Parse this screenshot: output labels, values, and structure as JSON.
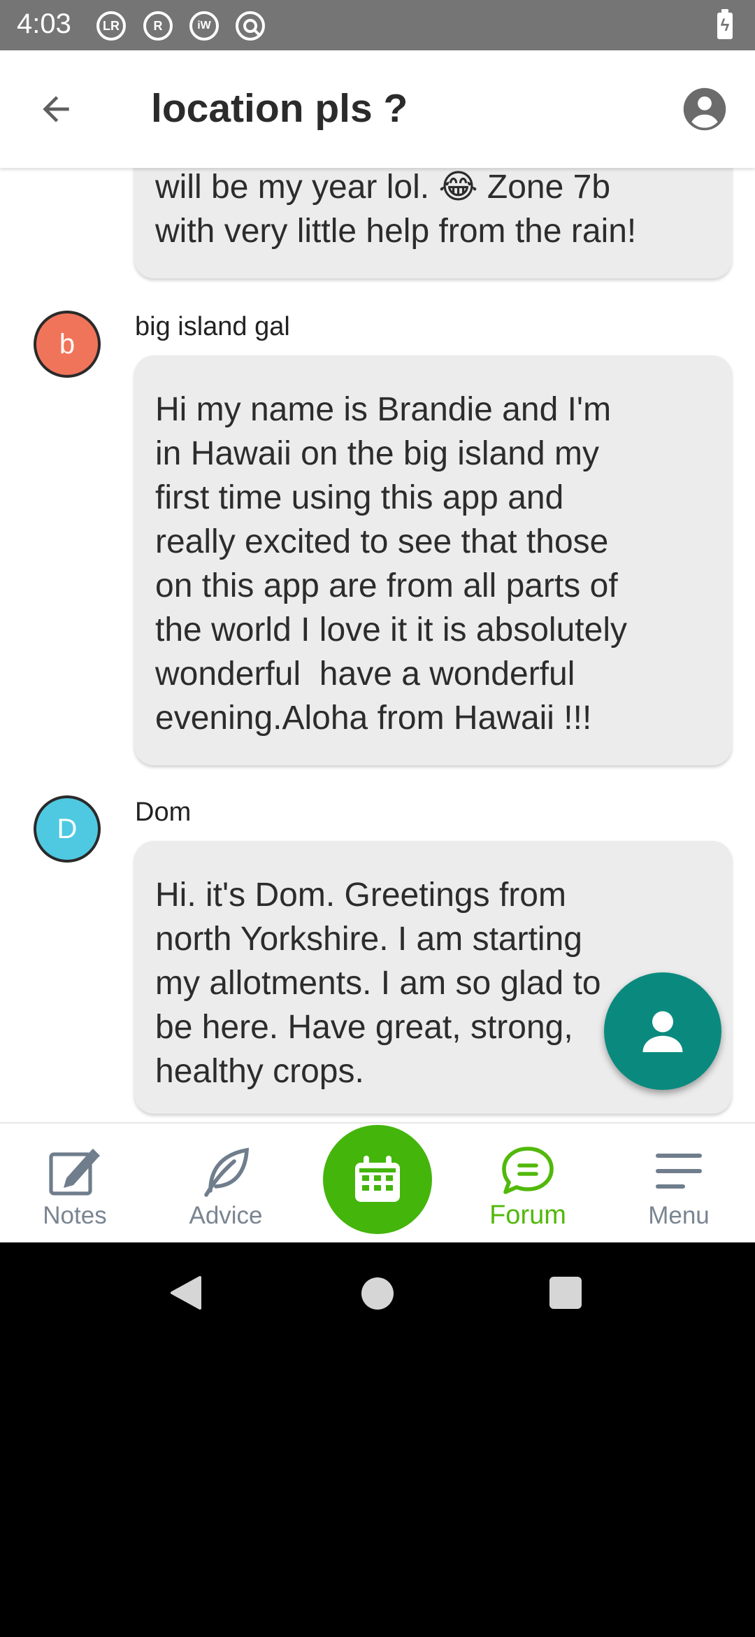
{
  "status_bar": {
    "time": "4:03",
    "icons": [
      {
        "name": "lr-notification-icon",
        "glyph": "LR"
      },
      {
        "name": "r-notification-icon",
        "glyph": "R"
      },
      {
        "name": "iw-notification-icon",
        "glyph": "iW"
      },
      {
        "name": "no-sign-icon",
        "glyph": ""
      }
    ],
    "battery_icon": "battery-charging-icon"
  },
  "header": {
    "title": "location pls ?",
    "back_icon": "arrow-left-icon",
    "profile_icon": "account-circle-icon"
  },
  "messages": [
    {
      "author": "",
      "avatar_letter": "",
      "text_before_emoji": "will be my year lol. ",
      "emoji": "😂",
      "text_after_emoji": " Zone 7b\nwith very little help from the rain!"
    },
    {
      "author": "big island gal",
      "avatar_letter": "b",
      "avatar_color": "#f0745a",
      "text": "Hi my name is Brandie and I'm\nin Hawaii on the big island my\nfirst time using this app and\nreally excited to see that those\non this app are from all parts of\nthe world I love it it is absolutely\nwonderful  have a wonderful\nevening.Aloha from Hawaii !!!"
    },
    {
      "author": "Dom",
      "avatar_letter": "D",
      "avatar_color": "#4ec9e1",
      "text": "Hi. it's Dom. Greetings from\nnorth Yorkshire. I am starting\nmy allotments. I am so glad to\nbe here. Have great, strong,\nhealthy crops."
    }
  ],
  "fab": {
    "icon": "person-icon"
  },
  "bottom_nav": {
    "items": [
      {
        "label": "Notes",
        "icon": "notes-edit-icon",
        "active": false
      },
      {
        "label": "Advice",
        "icon": "leaf-icon",
        "active": false
      },
      {
        "label": "Forum",
        "icon": "chat-bubble-icon",
        "active": true
      },
      {
        "label": "Menu",
        "icon": "hamburger-menu-icon",
        "active": false
      }
    ],
    "center_icon": "calendar-icon"
  },
  "colors": {
    "accent_green": "#44b50b",
    "forum_active": "#52b80a",
    "fab_teal": "#0a8a7e",
    "nav_gray": "#7a8591",
    "bubble_bg": "#ececec"
  },
  "system_nav": {
    "back_icon": "system-back-icon",
    "home_icon": "system-home-icon",
    "recents_icon": "system-recents-icon"
  }
}
